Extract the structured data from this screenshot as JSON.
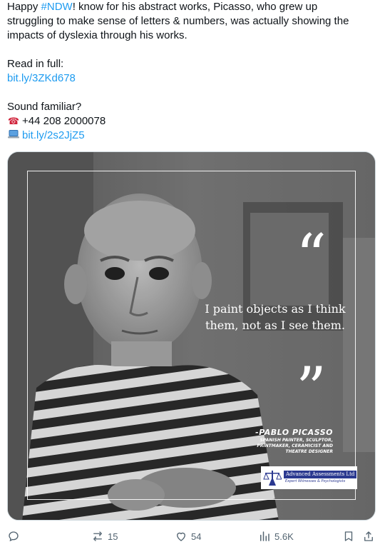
{
  "tweet": {
    "line1_prefix": "Happy ",
    "line1_hashtag": "#NDW",
    "line1_suffix": "! know for his abstract works, Picasso, who grew up",
    "line2": "struggling to make sense of letters & numbers, was actually showing the",
    "line3": "impacts of dyslexia through his works.",
    "read_label": "Read in full:",
    "read_link": "bit.ly/3ZKd678",
    "familiar_label": "Sound familiar?",
    "phone_emoji": "☎",
    "phone": "+44 208 2000078",
    "laptop_emoji": "💻",
    "web_link": "bit.ly/2s2JjZ5"
  },
  "media": {
    "quote_open": "“",
    "quote_line1": "I paint objects as I think",
    "quote_line2": "them, not as I see them.",
    "quote_close": "”",
    "author": "-PABLO PICASSO",
    "author_desc_line1": "SPANISH PAINTER, SCULPTOR,",
    "author_desc_line2": "PRINTMAKER, CERAMICIST AND",
    "author_desc_line3": "THEATRE DESIGNER",
    "logo_name": "Advanced Assessments Ltd",
    "logo_tagline": "Expert Witnesses & Psychologists"
  },
  "actions": {
    "replies_icon": "reply-icon",
    "retweets": "15",
    "likes": "54",
    "views": "5.6K",
    "bookmark_icon": "bookmark-icon",
    "share_icon": "share-icon"
  },
  "colors": {
    "link": "#1d9bf0",
    "text": "#0f1419",
    "muted": "#536471",
    "logo_blue": "#2b3990"
  }
}
